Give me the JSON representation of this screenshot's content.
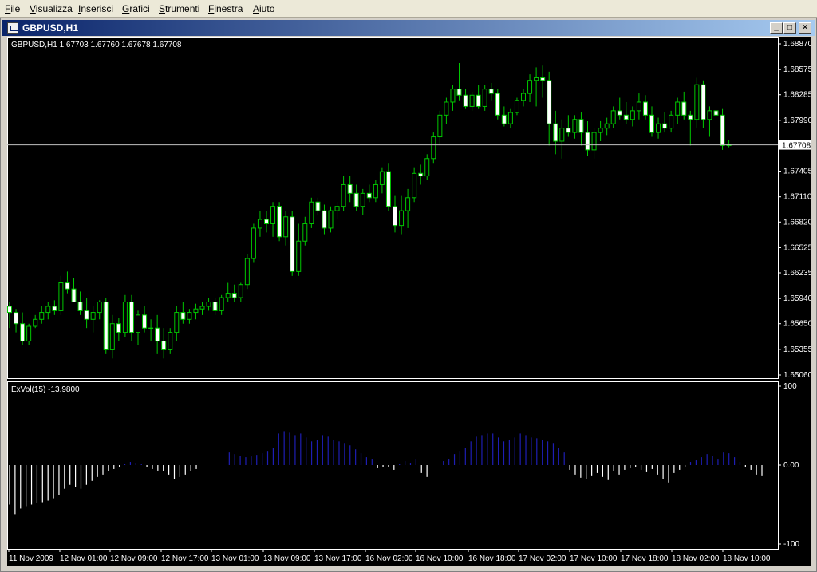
{
  "menu": [
    {
      "label": "File",
      "u": "F",
      "rest": "ile"
    },
    {
      "label": "Visualizza",
      "u": "V",
      "rest": "isualizza"
    },
    {
      "label": "Inserisci",
      "u": "I",
      "rest": "nserisci"
    },
    {
      "label": "Grafici",
      "u": "G",
      "rest": "rafici"
    },
    {
      "label": "Strumenti",
      "u": "S",
      "rest": "trumenti"
    },
    {
      "label": "Finestra",
      "u": "F",
      "rest": "inestra"
    },
    {
      "label": "Aiuto",
      "u": "A",
      "rest": "iuto"
    }
  ],
  "window": {
    "title": "GBPUSD,H1",
    "buttons": {
      "minimize": "_",
      "restore": "□",
      "close": "×"
    }
  },
  "colors": {
    "background": "#000000",
    "bull": "#00c800",
    "bull_body": "#000000",
    "bear_body": "#ffffff",
    "indicator_positive": "#1e1eb4",
    "indicator_negative": "#ffffff",
    "axis": "#ffffff",
    "current_price_line": "#c0c0c0"
  },
  "chart_data": [
    {
      "type": "candlestick",
      "header": "GBPUSD,H1  1.67703 1.67760 1.67678 1.67708",
      "symbol": "GBPUSD,H1",
      "ohlc_last": [
        1.67703,
        1.6776,
        1.67678,
        1.67708
      ],
      "current_price": "1.67708",
      "ylim": [
        1.6506,
        1.6887
      ],
      "y_ticks": [
        "1.68870",
        "1.68575",
        "1.68285",
        "1.67990",
        "1.67705",
        "1.67405",
        "1.67110",
        "1.66820",
        "1.66525",
        "1.66235",
        "1.65940",
        "1.65650",
        "1.65355",
        "1.65060"
      ],
      "grid": false,
      "candles": [
        [
          1.6585,
          1.659,
          1.656,
          1.6578
        ],
        [
          1.6578,
          1.6582,
          1.6555,
          1.6565
        ],
        [
          1.6565,
          1.6578,
          1.654,
          1.6545
        ],
        [
          1.6545,
          1.6565,
          1.654,
          1.6562
        ],
        [
          1.6562,
          1.6575,
          1.656,
          1.657
        ],
        [
          1.657,
          1.6585,
          1.6565,
          1.6578
        ],
        [
          1.6578,
          1.659,
          1.657,
          1.6585
        ],
        [
          1.6585,
          1.6592,
          1.6575,
          1.658
        ],
        [
          1.658,
          1.662,
          1.6575,
          1.6612
        ],
        [
          1.6612,
          1.6625,
          1.66,
          1.6605
        ],
        [
          1.6605,
          1.6618,
          1.659,
          1.659
        ],
        [
          1.659,
          1.6602,
          1.6575,
          1.658
        ],
        [
          1.658,
          1.6595,
          1.656,
          1.657
        ],
        [
          1.657,
          1.6585,
          1.6555,
          1.6578
        ],
        [
          1.6578,
          1.6592,
          1.657,
          1.659
        ],
        [
          1.659,
          1.6595,
          1.653,
          1.6535
        ],
        [
          1.6535,
          1.6575,
          1.6525,
          1.6565
        ],
        [
          1.6565,
          1.6572,
          1.6545,
          1.6555
        ],
        [
          1.6555,
          1.6598,
          1.655,
          1.659
        ],
        [
          1.659,
          1.6598,
          1.6545,
          1.6555
        ],
        [
          1.6555,
          1.658,
          1.654,
          1.6575
        ],
        [
          1.6575,
          1.6585,
          1.6555,
          1.656
        ],
        [
          1.656,
          1.657,
          1.6545,
          1.656
        ],
        [
          1.656,
          1.6575,
          1.653,
          1.6545
        ],
        [
          1.6545,
          1.656,
          1.6525,
          1.6535
        ],
        [
          1.6535,
          1.656,
          1.653,
          1.6555
        ],
        [
          1.6555,
          1.6585,
          1.6545,
          1.6578
        ],
        [
          1.6578,
          1.659,
          1.6565,
          1.657
        ],
        [
          1.657,
          1.6582,
          1.6565,
          1.6578
        ],
        [
          1.6578,
          1.6588,
          1.657,
          1.6582
        ],
        [
          1.6582,
          1.659,
          1.6575,
          1.6585
        ],
        [
          1.6585,
          1.6595,
          1.658,
          1.659
        ],
        [
          1.659,
          1.6595,
          1.6575,
          1.658
        ],
        [
          1.658,
          1.6598,
          1.6575,
          1.6595
        ],
        [
          1.6595,
          1.6612,
          1.659,
          1.66
        ],
        [
          1.66,
          1.661,
          1.659,
          1.6595
        ],
        [
          1.6595,
          1.6612,
          1.659,
          1.661
        ],
        [
          1.661,
          1.6645,
          1.6605,
          1.664
        ],
        [
          1.664,
          1.668,
          1.6635,
          1.6675
        ],
        [
          1.6675,
          1.6695,
          1.6665,
          1.6685
        ],
        [
          1.6685,
          1.6695,
          1.667,
          1.668
        ],
        [
          1.668,
          1.6705,
          1.6665,
          1.67
        ],
        [
          1.67,
          1.6705,
          1.666,
          1.6665
        ],
        [
          1.6665,
          1.6695,
          1.6655,
          1.6688
        ],
        [
          1.6688,
          1.6695,
          1.662,
          1.6625
        ],
        [
          1.6625,
          1.668,
          1.662,
          1.666
        ],
        [
          1.666,
          1.6688,
          1.6655,
          1.668
        ],
        [
          1.668,
          1.671,
          1.6675,
          1.6705
        ],
        [
          1.6705,
          1.671,
          1.669,
          1.6695
        ],
        [
          1.6695,
          1.6702,
          1.6668,
          1.6675
        ],
        [
          1.6675,
          1.67,
          1.667,
          1.6695
        ],
        [
          1.6695,
          1.6705,
          1.6685,
          1.67
        ],
        [
          1.67,
          1.6735,
          1.6695,
          1.6725
        ],
        [
          1.6725,
          1.6735,
          1.6705,
          1.6715
        ],
        [
          1.6715,
          1.6725,
          1.6695,
          1.67
        ],
        [
          1.67,
          1.672,
          1.669,
          1.6715
        ],
        [
          1.6715,
          1.6725,
          1.6705,
          1.671
        ],
        [
          1.671,
          1.673,
          1.6705,
          1.6725
        ],
        [
          1.6725,
          1.6745,
          1.6715,
          1.674
        ],
        [
          1.674,
          1.675,
          1.6695,
          1.67
        ],
        [
          1.67,
          1.6712,
          1.667,
          1.6678
        ],
        [
          1.6678,
          1.6712,
          1.6668,
          1.6695
        ],
        [
          1.6695,
          1.672,
          1.6675,
          1.671
        ],
        [
          1.671,
          1.6745,
          1.6705,
          1.6738
        ],
        [
          1.6738,
          1.6748,
          1.6725,
          1.6735
        ],
        [
          1.6735,
          1.676,
          1.673,
          1.6755
        ],
        [
          1.6755,
          1.6785,
          1.675,
          1.678
        ],
        [
          1.678,
          1.681,
          1.677,
          1.6805
        ],
        [
          1.6805,
          1.6825,
          1.6795,
          1.682
        ],
        [
          1.682,
          1.684,
          1.681,
          1.6835
        ],
        [
          1.6835,
          1.6865,
          1.6822,
          1.6828
        ],
        [
          1.6828,
          1.6835,
          1.6812,
          1.6815
        ],
        [
          1.6815,
          1.6832,
          1.681,
          1.6828
        ],
        [
          1.6828,
          1.684,
          1.6812,
          1.6815
        ],
        [
          1.6815,
          1.684,
          1.681,
          1.6835
        ],
        [
          1.6835,
          1.6842,
          1.6822,
          1.683
        ],
        [
          1.683,
          1.6835,
          1.68,
          1.6805
        ],
        [
          1.6805,
          1.6815,
          1.6792,
          1.6795
        ],
        [
          1.6795,
          1.6812,
          1.679,
          1.6808
        ],
        [
          1.6808,
          1.6825,
          1.6805,
          1.6822
        ],
        [
          1.6822,
          1.6835,
          1.6815,
          1.683
        ],
        [
          1.683,
          1.6852,
          1.682,
          1.6845
        ],
        [
          1.6845,
          1.686,
          1.6815,
          1.6848
        ],
        [
          1.6848,
          1.6862,
          1.6825,
          1.6845
        ],
        [
          1.6845,
          1.6855,
          1.677,
          1.6795
        ],
        [
          1.6795,
          1.681,
          1.676,
          1.6775
        ],
        [
          1.6775,
          1.68,
          1.6755,
          1.679
        ],
        [
          1.679,
          1.6805,
          1.678,
          1.6785
        ],
        [
          1.6785,
          1.6805,
          1.6778,
          1.68
        ],
        [
          1.68,
          1.6808,
          1.677,
          1.6785
        ],
        [
          1.6785,
          1.6798,
          1.6758,
          1.6765
        ],
        [
          1.6765,
          1.679,
          1.6755,
          1.6785
        ],
        [
          1.6785,
          1.6798,
          1.6775,
          1.679
        ],
        [
          1.679,
          1.6802,
          1.6782,
          1.6795
        ],
        [
          1.6795,
          1.6815,
          1.679,
          1.681
        ],
        [
          1.681,
          1.6825,
          1.68,
          1.6805
        ],
        [
          1.6805,
          1.682,
          1.6795,
          1.68
        ],
        [
          1.68,
          1.6815,
          1.6792,
          1.681
        ],
        [
          1.681,
          1.683,
          1.68,
          1.682
        ],
        [
          1.682,
          1.6828,
          1.68,
          1.6805
        ],
        [
          1.6805,
          1.6815,
          1.678,
          1.6785
        ],
        [
          1.6785,
          1.6802,
          1.6778,
          1.6795
        ],
        [
          1.6795,
          1.6808,
          1.6785,
          1.679
        ],
        [
          1.679,
          1.681,
          1.6785,
          1.6805
        ],
        [
          1.6805,
          1.6825,
          1.6795,
          1.682
        ],
        [
          1.682,
          1.6832,
          1.68,
          1.6805
        ],
        [
          1.6805,
          1.681,
          1.677,
          1.68
        ],
        [
          1.68,
          1.6848,
          1.679,
          1.684
        ],
        [
          1.684,
          1.6845,
          1.679,
          1.68
        ],
        [
          1.68,
          1.6815,
          1.678,
          1.681
        ],
        [
          1.681,
          1.6822,
          1.6795,
          1.6805
        ],
        [
          1.6805,
          1.6812,
          1.6765,
          1.677
        ],
        [
          1.677,
          1.6776,
          1.6768,
          1.6771
        ]
      ]
    },
    {
      "type": "bar",
      "header": "ExVol(15) -13.9800",
      "name": "ExVol(15)",
      "last_value": "-13.9800",
      "ylim": [
        -100,
        100
      ],
      "y_ticks": [
        "100",
        "0.00",
        "-100"
      ],
      "values": [
        -50,
        -62,
        -55,
        -52,
        -50,
        -48,
        -47,
        -45,
        -42,
        -38,
        -30,
        -25,
        -28,
        -30,
        -25,
        -20,
        -15,
        -12,
        -8,
        -5,
        -2,
        2,
        4,
        3,
        2,
        -3,
        -5,
        -7,
        -8,
        -12,
        -18,
        -15,
        -12,
        -8,
        -5,
        0,
        0,
        0,
        0,
        0,
        16,
        14,
        12,
        10,
        11,
        13,
        15,
        18,
        22,
        40,
        43,
        41,
        38,
        40,
        35,
        30,
        32,
        38,
        36,
        32,
        30,
        28,
        25,
        20,
        15,
        10,
        8,
        -4,
        -3,
        -2,
        -6,
        2,
        5,
        3,
        8,
        -10,
        -15,
        0,
        0,
        5,
        8,
        14,
        18,
        22,
        30,
        36,
        38,
        40,
        40,
        35,
        30,
        32,
        35,
        40,
        38,
        35,
        34,
        32,
        30,
        28,
        22,
        16,
        -6,
        -12,
        -16,
        -18,
        -14,
        -10,
        -15,
        -19,
        -8,
        -12,
        -6,
        -4,
        -3,
        -6,
        -9,
        -5,
        -12,
        -18,
        -22,
        -10,
        -6,
        -3,
        4,
        6,
        10,
        14,
        12,
        8,
        16,
        15,
        10,
        4,
        -2,
        -6,
        -12,
        -14
      ]
    }
  ],
  "x_axis_labels": [
    "11 Nov 2009",
    "12 Nov 01:00",
    "12 Nov 09:00",
    "12 Nov 17:00",
    "13 Nov 01:00",
    "13 Nov 09:00",
    "13 Nov 17:00",
    "16 Nov 02:00",
    "16 Nov 10:00",
    "16 Nov 18:00",
    "17 Nov 02:00",
    "17 Nov 10:00",
    "17 Nov 18:00",
    "18 Nov 02:00",
    "18 Nov 10:00"
  ]
}
